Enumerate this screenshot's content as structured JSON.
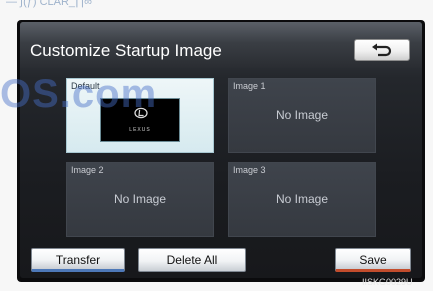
{
  "document": {
    "header_fragment": "— ∫(ƒ) CLAR_∏∞",
    "watermark": "OS.com"
  },
  "screen": {
    "title": "Customize Startup Image",
    "back_icon": "return-arrow-icon"
  },
  "tiles": [
    {
      "label": "Default",
      "content": "",
      "thumbnail_caption": "LEXUS",
      "selected": true
    },
    {
      "label": "Image 1",
      "content": "No Image",
      "selected": false
    },
    {
      "label": "Image 2",
      "content": "No Image",
      "selected": false
    },
    {
      "label": "Image 3",
      "content": "No Image",
      "selected": false
    }
  ],
  "buttons": {
    "transfer": "Transfer",
    "delete_all": "Delete All",
    "save": "Save"
  },
  "figure_code": "IISKG0029U",
  "colors": {
    "accent_blue": "#4d78b8",
    "accent_red": "#c24c2c",
    "selected_tile": "#d6eaef"
  }
}
